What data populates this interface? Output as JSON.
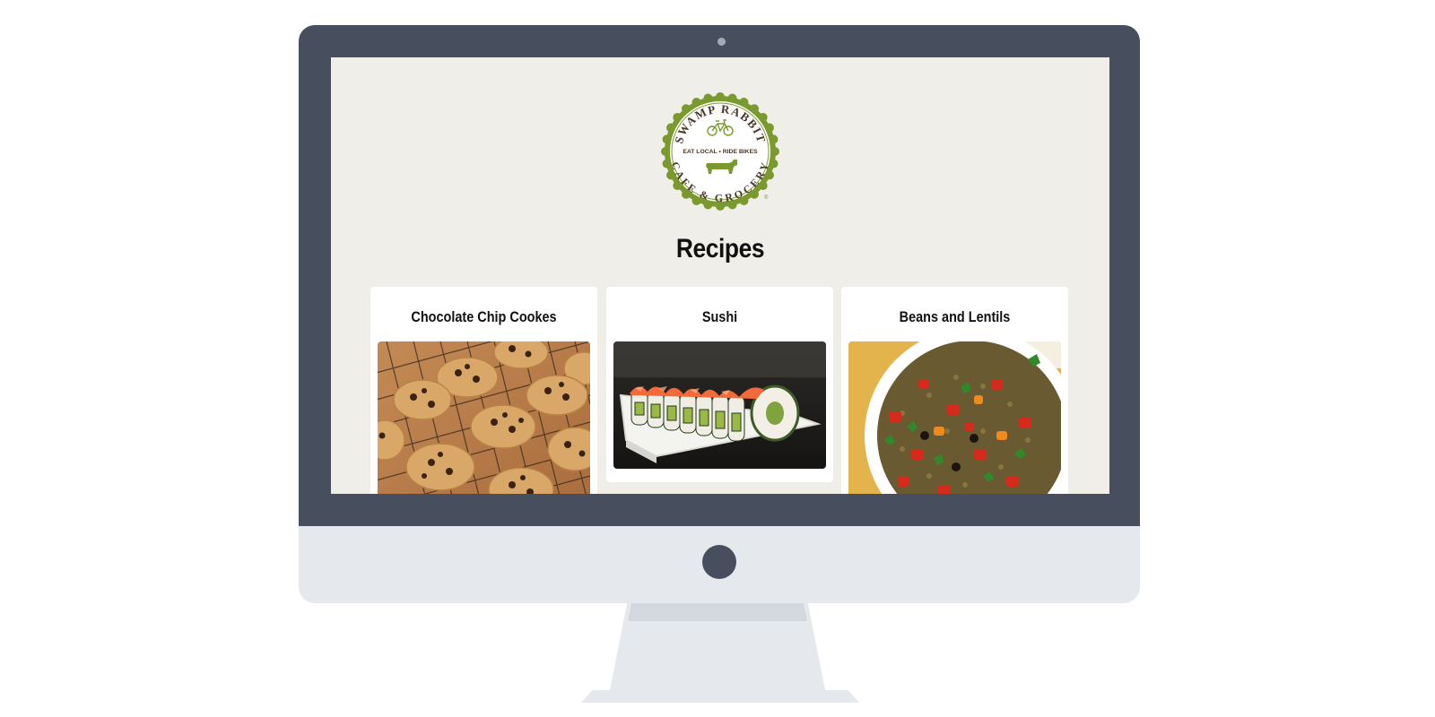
{
  "logo": {
    "arc_top": "SWAMP RABBIT",
    "tagline": "EAT LOCAL • RIDE BIKES",
    "arc_bottom": "CAFE & GROCERY",
    "registered": "®",
    "colors": {
      "ring": "#7a9a2e",
      "text": "#4a3728"
    }
  },
  "page": {
    "title": "Recipes",
    "background": "#f0eee8"
  },
  "recipes": [
    {
      "title": "Chocolate Chip Cookes",
      "image": "cookies-photo"
    },
    {
      "title": "Sushi",
      "image": "sushi-photo"
    },
    {
      "title": "Beans and Lentils",
      "image": "lentil-salad-photo"
    }
  ],
  "device": {
    "bezel_color": "#474f5e",
    "chin_color": "#e5e8ed"
  }
}
